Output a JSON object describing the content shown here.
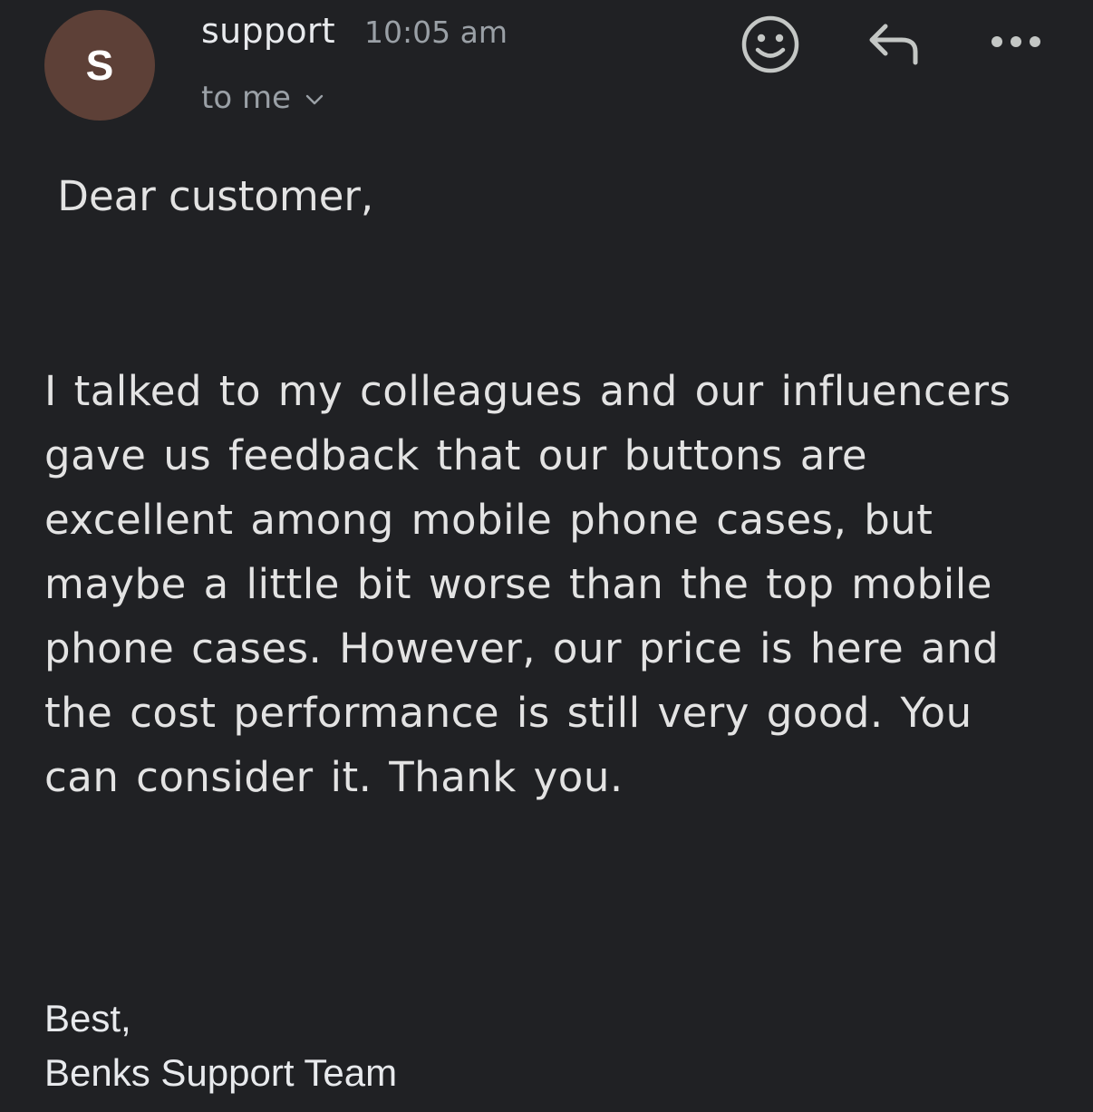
{
  "header": {
    "avatar_letter": "S",
    "avatar_color": "#5d4037",
    "sender": "support",
    "time": "10:05 am",
    "recipient": "to me",
    "icons": [
      "emoji-icon",
      "reply-icon",
      "more-options-icon",
      "chevron-down-icon"
    ]
  },
  "message": {
    "greeting": " Dear customer,",
    "body": "I talked to my colleagues and our influencers gave us feedback that our buttons are excellent among mobile phone cases, but maybe a little bit worse than the top mobile phone cases. However, our price is here and the cost performance is still very good. You can consider it. Thank you.",
    "closing": "Best,",
    "signature": "Benks Support Team"
  },
  "colors": {
    "background": "#202124",
    "text": "#e3e3e3",
    "secondary_text": "#9aa0a6"
  }
}
